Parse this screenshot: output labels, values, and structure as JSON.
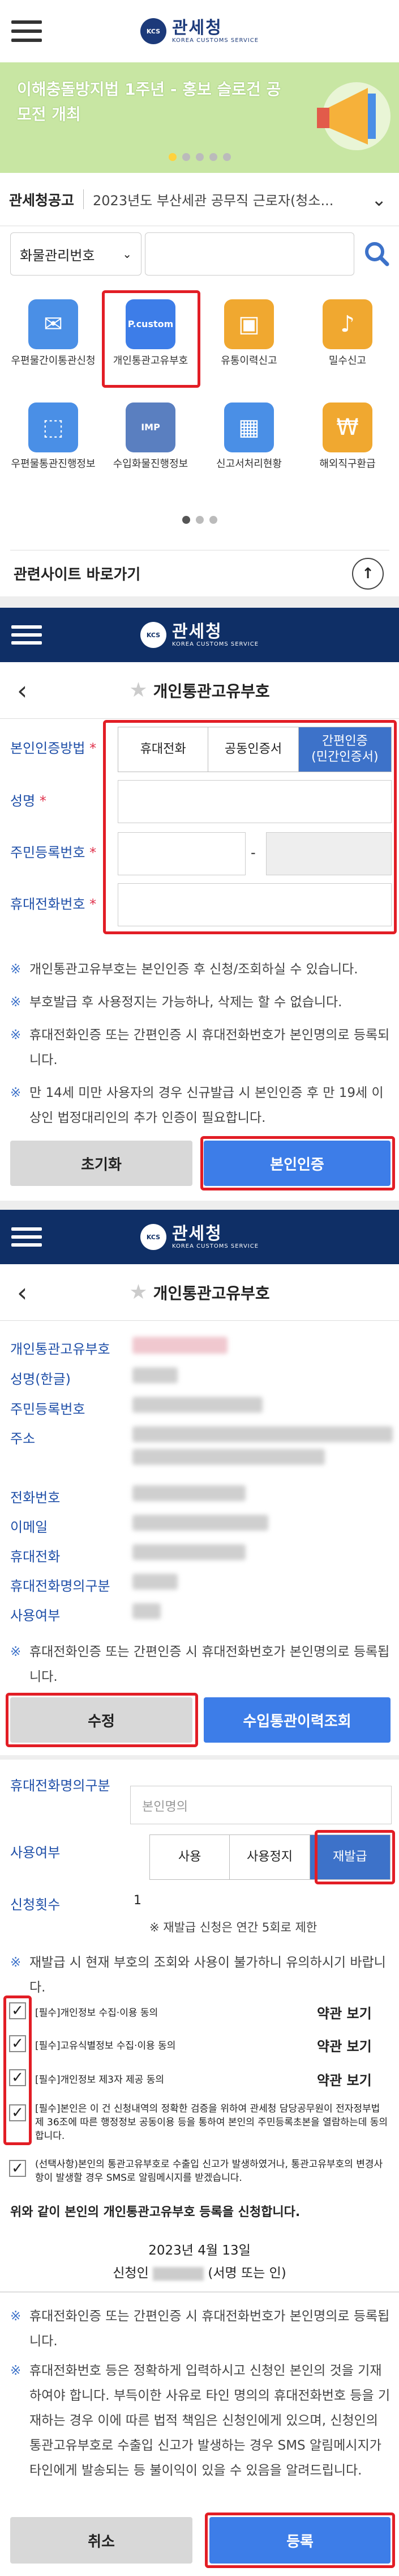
{
  "header": {
    "logo_ko": "관세청",
    "logo_en": "KOREA CUSTOMS SERVICE",
    "emblem_text": "KCS"
  },
  "banner": {
    "text": "이해충돌방지법 1주년 - 홍보 슬로건 공모전 개최"
  },
  "notice": {
    "label": "관세청공고",
    "text": "2023년도 부산세관 공무직 근로자(청소..."
  },
  "search": {
    "select_value": "화물관리번호"
  },
  "menu": [
    {
      "label": "우편물간이통관신청",
      "icon": "mail-icon",
      "color": "#4a8fe6"
    },
    {
      "label": "개인통관고유부호",
      "icon": "id-card-icon",
      "color": "#3d7de8",
      "badge": "P.custom"
    },
    {
      "label": "유통이력신고",
      "icon": "box-icon",
      "color": "#f0a830"
    },
    {
      "label": "밀수신고",
      "icon": "bell-icon",
      "color": "#f0a830"
    },
    {
      "label": "우편물통관진행정보",
      "icon": "parcel-icon",
      "color": "#4a8fe6"
    },
    {
      "label": "수입화물진행정보",
      "icon": "imp-icon",
      "color": "#5a7fc0",
      "badge": "IMP"
    },
    {
      "label": "신고서처리현황",
      "icon": "folder-icon",
      "color": "#4a8fe6"
    },
    {
      "label": "해외직구환급",
      "icon": "money-icon",
      "color": "#f0a830"
    }
  ],
  "related": {
    "label": "관련사이트 바로가기"
  },
  "page_title": "개인통관고유부호",
  "cert": {
    "method_label": "본인인증방법",
    "tabs": [
      "휴대전화",
      "공동인증서",
      "간편인증\n(민간인증서)"
    ],
    "name_label": "성명",
    "rrn_label": "주민등록번호",
    "rrn_sep": "-",
    "phone_label": "휴대전화번호",
    "notes": [
      "개인통관고유부호는 본인인증 후 신청/조회하실 수 있습니다.",
      "부호발급 후 사용정지는 가능하나, 삭제는 할 수 없습니다.",
      "휴대전화인증 또는 간편인증 시 휴대전화번호가 본인명의로 등록되니다.",
      "만 14세 미만 사용자의 경우 신규발급 시 본인인증 후 만 19세 이상인 법정대리인의 추가 인증이 필요합니다."
    ],
    "reset_button": "초기화",
    "verify_button": "본인인증"
  },
  "info": {
    "rows": [
      "개인통관고유부호",
      "성명(한글)",
      "주민등록번호",
      "주소",
      "전화번호",
      "이메일",
      "휴대전화",
      "휴대전화명의구분",
      "사용여부"
    ],
    "note": "휴대전화인증 또는 간편인증 시 휴대전화번호가 본인명의로 등록됩니다.",
    "edit_button": "수정",
    "history_button": "수입통관이력조회"
  },
  "reissue": {
    "owner_label": "휴대전화명의구분",
    "owner_value": "본인명의",
    "status_label": "사용여부",
    "status_tabs": [
      "사용",
      "사용정지",
      "재발급"
    ],
    "count_label": "신청횟수",
    "count_value": "1",
    "limit_note": "※ 재발급 신청은 연간 5회로 제한",
    "warn": "재발급 시 현재 부호의 조회와 사용이 불가하니 유의하시기 바랍니다.",
    "agreements": [
      {
        "text": "[필수]개인정보 수집·이용 동의",
        "view": "약관 보기"
      },
      {
        "text": "[필수]고유식별정보 수집·이용 동의",
        "view": "약관 보기"
      },
      {
        "text": "[필수]개인정보 제3자 제공 동의",
        "view": "약관 보기"
      }
    ],
    "consent_long": "[필수]본인은 이 건 신청내역의 정확한 검증을 위하여 관세청 담당공무원이 전자정부법 제 36조에 따른 행정정보 공동이용 등을 통하여 본인의 주민등록초본을 열람하는데 동의합니다.",
    "consent_optional": "(선택사항)본인의 통관고유부호로 수출입 신고가 발생하였거나, 통관고유부호의 변경사항이 발생할 경우 SMS로 알림메시지를 받겠습니다.",
    "apply_text": "위와 같이 본인의 개인통관고유부호 등록을 신청합니다.",
    "date": "2023년 4월 13일",
    "signer_prefix": "신청인",
    "signer_suffix": "(서명 또는 인)",
    "notes": [
      "휴대전화인증 또는 간편인증 시 휴대전화번호가 본인명의로 등록됩니다.",
      "휴대전화번호 등은 정확하게 입력하시고 신청인 본인의 것을 기재하여야 합니다. 부득이한 사유로 타인 명의의 휴대전화번호 등을 기재하는 경우 이에 따른 법적 책임은 신청인에게 있으며, 신청인의 통관고유부호로 수출입 신고가 발생하는 경우 SMS 알림메시지가 타인에게 발송되는 등 불이익이 있을 수 있음을 알려드립니다."
    ],
    "cancel_button": "취소",
    "submit_button": "등록"
  }
}
